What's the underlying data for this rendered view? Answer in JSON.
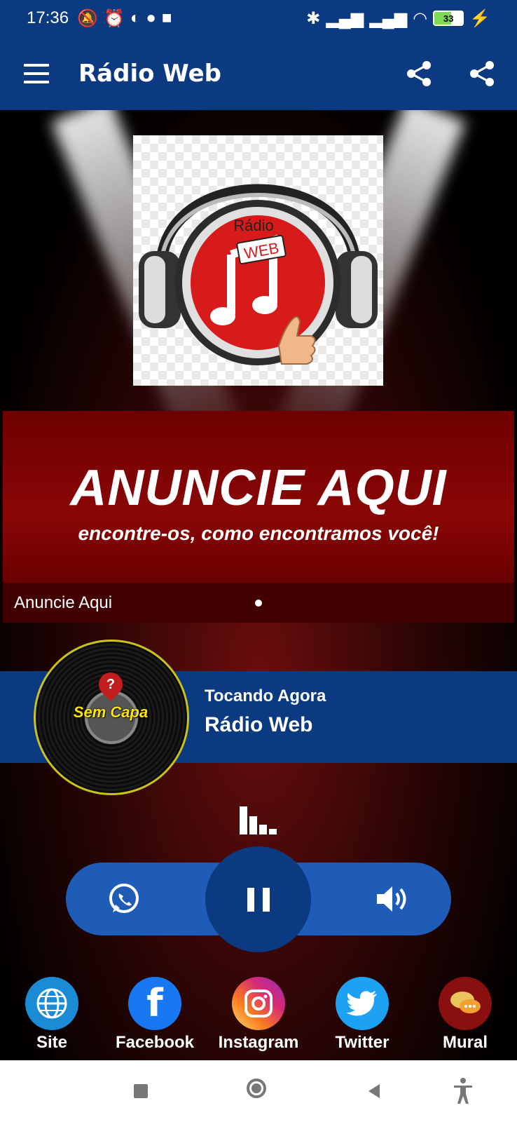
{
  "status_bar": {
    "time": "17:36",
    "battery": "33"
  },
  "app_bar": {
    "title": "Rádio Web"
  },
  "logo": {
    "top_text": "Rádio",
    "badge_text": "WEB"
  },
  "banner": {
    "headline": "ANUNCIE AQUI",
    "subline": "encontre-os, como encontramos você!",
    "caption": "Anuncie Aqui"
  },
  "now_playing": {
    "label": "Tocando Agora",
    "title": "Rádio Web",
    "cover_text": "Sem Capa",
    "cover_mark": "?"
  },
  "socials": [
    {
      "label": "Site",
      "icon": "globe-icon",
      "color": "#1b8bd6"
    },
    {
      "label": "Facebook",
      "icon": "facebook-icon",
      "color": "#1778f2"
    },
    {
      "label": "Instagram",
      "icon": "instagram-icon",
      "color": "#d62976"
    },
    {
      "label": "Twitter",
      "icon": "twitter-icon",
      "color": "#1da1f2"
    },
    {
      "label": "Mural",
      "icon": "chat-bubbles-icon",
      "color": "#8a1010"
    }
  ],
  "colors": {
    "primary": "#0b3a80",
    "control_pill": "#1f5cb8"
  }
}
